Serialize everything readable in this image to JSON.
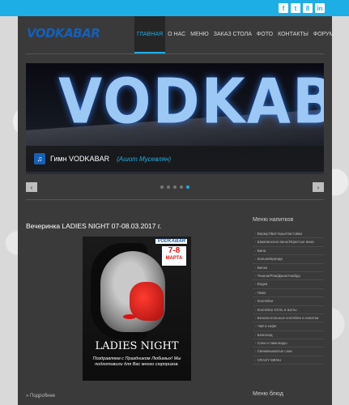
{
  "social": [
    "f",
    "t",
    "8",
    "in"
  ],
  "logo": "VODKABAR",
  "nav": [
    "Главная",
    "О нас",
    "Меню",
    "Заказ стола",
    "Фото",
    "Контакты",
    "Форум"
  ],
  "slider": {
    "sign": "VODKABAR",
    "caption_title": "Гимн VODKABAR",
    "caption_author": "(Ашот Мусевлян)"
  },
  "controls": {
    "prev": "‹",
    "next": "›"
  },
  "post": {
    "title": "Вечеринка LADIES NIGHT 07-08.03.2017 г.",
    "poster_logo": "VODKABAR",
    "poster_date": "7-8",
    "poster_month": "МАРТА",
    "poster_heading": "LADIES NIGHT",
    "poster_message": "Поздравляем с Праздником Любимых! Мы подготовили для Вас много сюрпризов.",
    "more": "» Подробнее"
  },
  "sidebar": {
    "heading": "Меню напитков",
    "items": [
      "Вермут/Биттеры/Настойки",
      "Шампанское вино/Игристые вина",
      "Вина",
      "Коньяк/Бренди",
      "Виски",
      "Текила/Ром/Джин/Анабдо",
      "Водка",
      "Пиво",
      "Коктейли",
      "Коктейли XXXL и Шоты",
      "Безалкогольные коктейли и напитки",
      "Чай и кофе",
      "Шоколад",
      "Соки и лимонады",
      "Свежевыжатые соки",
      "CRAZY MENU"
    ],
    "heading2": "Меню блюд"
  }
}
